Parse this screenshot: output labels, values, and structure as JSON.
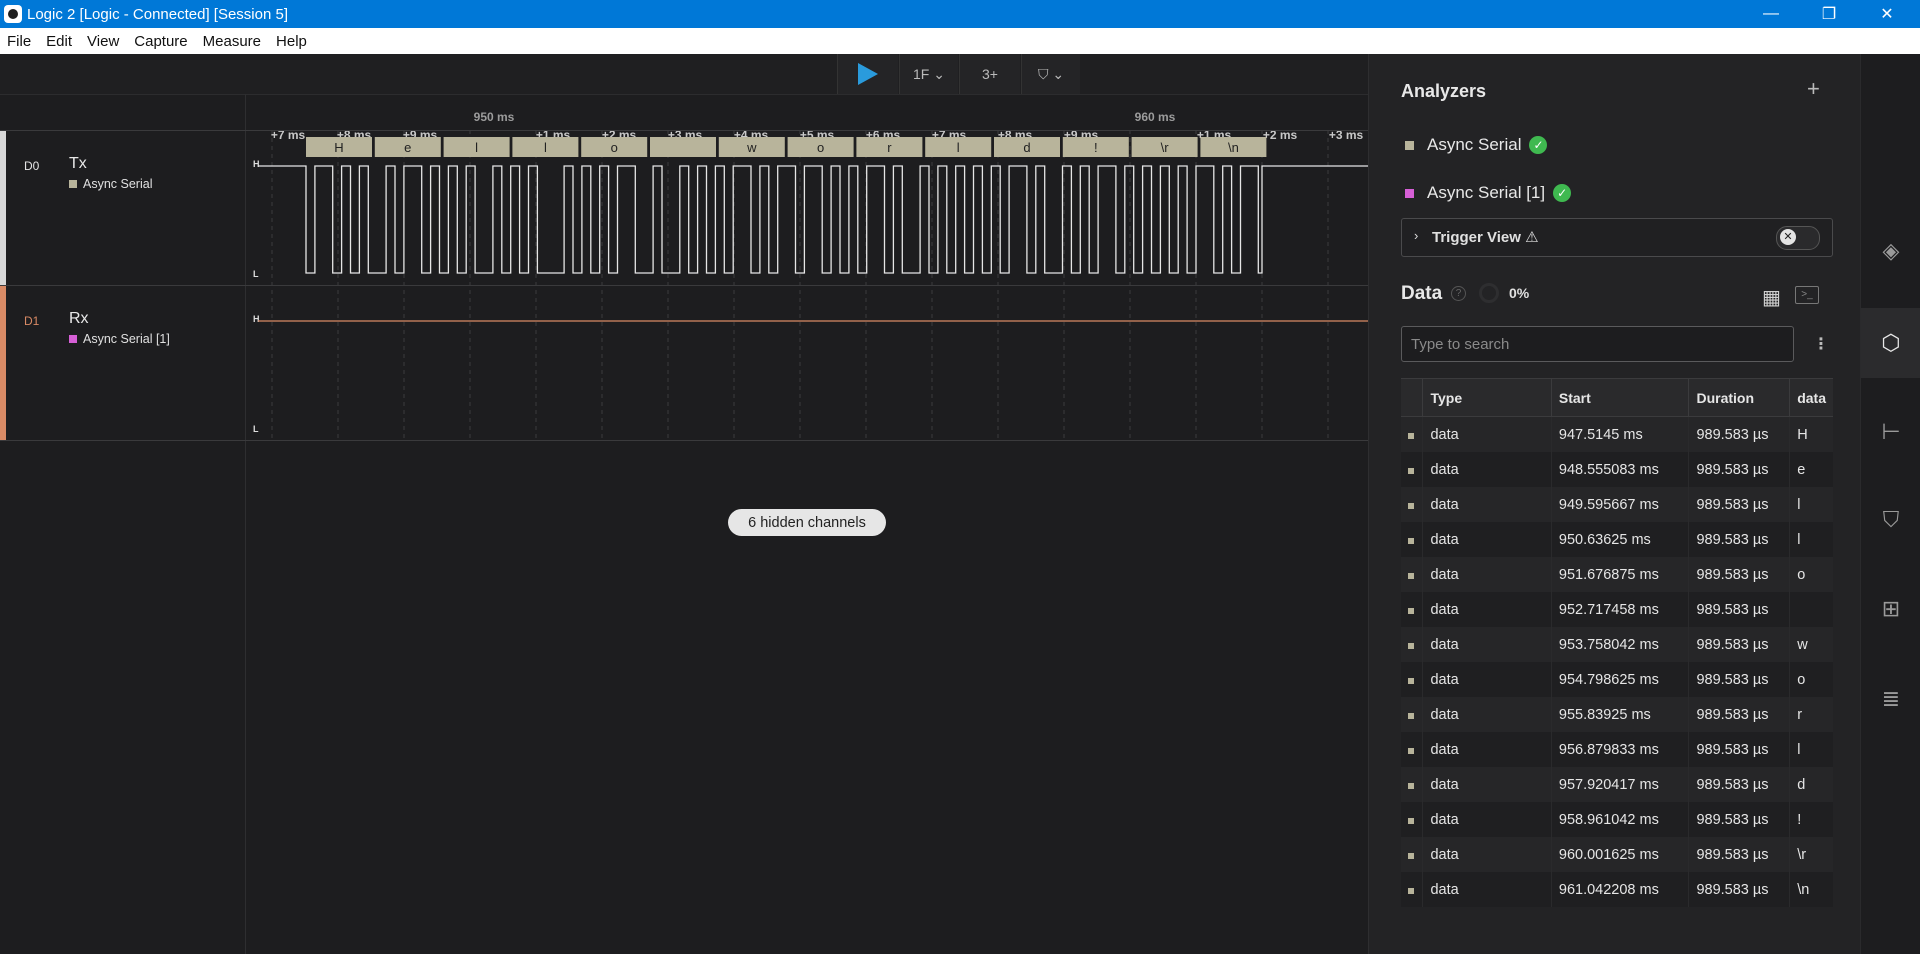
{
  "window": {
    "title": "Logic 2 [Logic - Connected] [Session 5]",
    "controls": {
      "minimize": "—",
      "maximize": "❐",
      "close": "✕"
    }
  },
  "menu": [
    "File",
    "Edit",
    "View",
    "Capture",
    "Measure",
    "Help"
  ],
  "toolbar": {
    "play_icon": "play-icon",
    "analyzer_icon": "1F",
    "measure_icon": "3+",
    "timing_marker_icon": "flag-icon",
    "chevron": "⌄"
  },
  "ruler": {
    "major": [
      {
        "label": "950 ms"
      },
      {
        "label": "960 ms"
      }
    ],
    "minor": [
      "+7 ms",
      "+8 ms",
      "+9 ms",
      "+1 ms",
      "+2 ms",
      "+3 ms",
      "+4 ms",
      "+5 ms",
      "+6 ms",
      "+7 ms",
      "+8 ms",
      "+9 ms",
      "+1 ms",
      "+2 ms",
      "+3 ms"
    ]
  },
  "channels": [
    {
      "num": "D0",
      "name": "Tx",
      "color": "#d8d8d8",
      "analyzer": "Async Serial",
      "analyzer_color": "#b8b49b",
      "high": "H",
      "low": "L"
    },
    {
      "num": "D1",
      "name": "Rx",
      "color": "#d98a65",
      "analyzer": "Async Serial [1]",
      "analyzer_color": "#d65fd6",
      "high": "H",
      "low": "L"
    }
  ],
  "decoded_bytes": [
    "H",
    "e",
    "l",
    "l",
    "o",
    "",
    "w",
    "o",
    "r",
    "l",
    "d",
    "!",
    "\\r",
    "\\n"
  ],
  "hidden_channels": "6 hidden channels",
  "analyzers_panel": {
    "title": "Analyzers",
    "add": "+",
    "items": [
      {
        "name": "Async Serial",
        "color": "#b8b49b",
        "status": "✓"
      },
      {
        "name": "Async Serial [1]",
        "color": "#d65fd6",
        "status": "✓"
      }
    ],
    "trigger_view": {
      "label": "Trigger View ⚠",
      "chevron": "›",
      "toggle_icon": "✕"
    }
  },
  "data_panel": {
    "title": "Data",
    "help": "?",
    "progress": "0%",
    "grid_icon": "▦",
    "terminal_icon": ">_",
    "search_placeholder": "Type to search",
    "menu": "⋮",
    "columns": [
      "",
      "Type",
      "Start",
      "Duration",
      "data"
    ],
    "rows": [
      {
        "type": "data",
        "start": "947.5145 ms",
        "duration": "989.583 µs",
        "data": "H"
      },
      {
        "type": "data",
        "start": "948.555083 ms",
        "duration": "989.583 µs",
        "data": "e"
      },
      {
        "type": "data",
        "start": "949.595667 ms",
        "duration": "989.583 µs",
        "data": "l"
      },
      {
        "type": "data",
        "start": "950.63625 ms",
        "duration": "989.583 µs",
        "data": "l"
      },
      {
        "type": "data",
        "start": "951.676875 ms",
        "duration": "989.583 µs",
        "data": "o"
      },
      {
        "type": "data",
        "start": "952.717458 ms",
        "duration": "989.583 µs",
        "data": ""
      },
      {
        "type": "data",
        "start": "953.758042 ms",
        "duration": "989.583 µs",
        "data": "w"
      },
      {
        "type": "data",
        "start": "954.798625 ms",
        "duration": "989.583 µs",
        "data": "o"
      },
      {
        "type": "data",
        "start": "955.83925 ms",
        "duration": "989.583 µs",
        "data": "r"
      },
      {
        "type": "data",
        "start": "956.879833 ms",
        "duration": "989.583 µs",
        "data": "l"
      },
      {
        "type": "data",
        "start": "957.920417 ms",
        "duration": "989.583 µs",
        "data": "d"
      },
      {
        "type": "data",
        "start": "958.961042 ms",
        "duration": "989.583 µs",
        "data": "!"
      },
      {
        "type": "data",
        "start": "960.001625 ms",
        "duration": "989.583 µs",
        "data": "\\r"
      },
      {
        "type": "data",
        "start": "961.042208 ms",
        "duration": "989.583 µs",
        "data": "\\n"
      }
    ]
  },
  "rail": [
    {
      "icon": "layers-icon",
      "glyph": "◈",
      "active": false
    },
    {
      "icon": "analyzers-icon",
      "glyph": "⬡",
      "active": true
    },
    {
      "icon": "measurements-icon",
      "glyph": "⊢",
      "active": false
    },
    {
      "icon": "timing-markers-icon",
      "glyph": "⛉",
      "active": false
    },
    {
      "icon": "extensions-icon",
      "glyph": "⊞",
      "active": false
    },
    {
      "icon": "notes-icon",
      "glyph": "≣",
      "active": false
    }
  ]
}
